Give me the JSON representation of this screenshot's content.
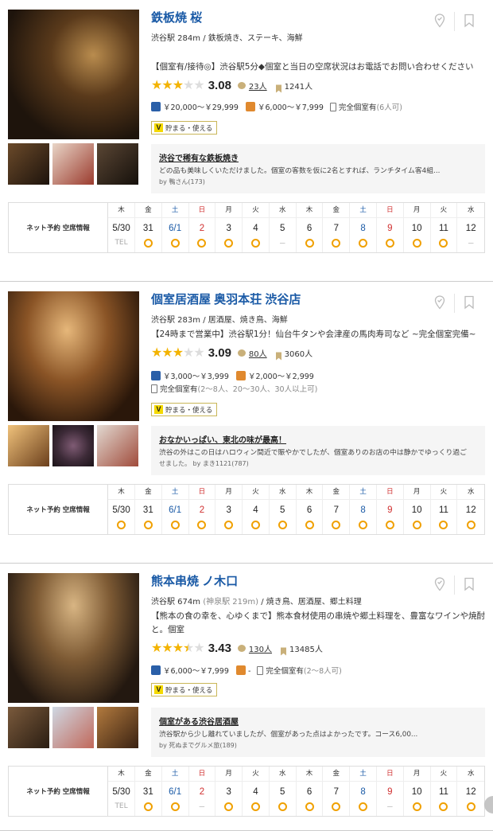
{
  "restaurants": [
    {
      "name": "鉄板焼 桜",
      "station": "渋谷駅 284m",
      "alt_station": "",
      "genres": "鉄板焼き、ステーキ、海鮮",
      "catch": "【個室有/接待◎】渋谷駅5分◆個室と当日の空席状況はお電話でお問い合わせください",
      "rating": 3.08,
      "rating_text": "3.08",
      "review_count": "23人",
      "bookmark_count": "1241人",
      "dinner_price": "￥20,000～￥29,999",
      "lunch_price": "￥6,000～￥7,999",
      "room_text": "完全個室有",
      "room_detail": "(6人可)",
      "points_label": "貯まる・使える",
      "review_title": "渋谷で稀有な鉄板焼き",
      "review_body": "どの品も美味しくいただけました。個室の客数を仮に2名とすれば、ランチタイム客4組...",
      "review_by": "by 鴨さん(173)",
      "availability_label": "ネット予約 空席情報",
      "days": [
        {
          "dow": "木",
          "date": "5/30",
          "mark": "TEL",
          "kind": "wd"
        },
        {
          "dow": "金",
          "date": "31",
          "mark": "o",
          "kind": "wd"
        },
        {
          "dow": "土",
          "date": "6/1",
          "mark": "o",
          "kind": "sat"
        },
        {
          "dow": "日",
          "date": "2",
          "mark": "o",
          "kind": "sun"
        },
        {
          "dow": "月",
          "date": "3",
          "mark": "o",
          "kind": "wd"
        },
        {
          "dow": "火",
          "date": "4",
          "mark": "o",
          "kind": "wd"
        },
        {
          "dow": "水",
          "date": "5",
          "mark": "－",
          "kind": "wd"
        },
        {
          "dow": "木",
          "date": "6",
          "mark": "o",
          "kind": "wd"
        },
        {
          "dow": "金",
          "date": "7",
          "mark": "o",
          "kind": "wd"
        },
        {
          "dow": "土",
          "date": "8",
          "mark": "o",
          "kind": "sat"
        },
        {
          "dow": "日",
          "date": "9",
          "mark": "o",
          "kind": "sun"
        },
        {
          "dow": "月",
          "date": "10",
          "mark": "o",
          "kind": "wd"
        },
        {
          "dow": "火",
          "date": "11",
          "mark": "o",
          "kind": "wd"
        },
        {
          "dow": "水",
          "date": "12",
          "mark": "－",
          "kind": "wd"
        }
      ]
    },
    {
      "name": "個室居酒屋 奥羽本荘 渋谷店",
      "station": "渋谷駅 283m",
      "alt_station": "",
      "genres": "居酒屋、焼き鳥、海鮮",
      "catch": "【24時まで営業中】渋谷駅1分！仙台牛タンや会津産の馬肉寿司など ~完全個室完備~",
      "rating": 3.09,
      "rating_text": "3.09",
      "review_count": "80人",
      "bookmark_count": "3060人",
      "dinner_price": "￥3,000～￥3,999",
      "lunch_price": "￥2,000～￥2,999",
      "room_text": "完全個室有",
      "room_detail": "(2～8人、20～30人、30人以上可)",
      "points_label": "貯まる・使える",
      "review_title": "おなかいっぱい、東北の味が最高！",
      "review_body": "渋谷の外はこの日はハロウィン間近で賑やかでしたが、個室ありのお店の中は静かでゆっくり過ご",
      "review_body2": "せました。",
      "review_by": "by まき1121(787)",
      "availability_label": "ネット予約 空席情報",
      "days": [
        {
          "dow": "木",
          "date": "5/30",
          "mark": "o",
          "kind": "wd"
        },
        {
          "dow": "金",
          "date": "31",
          "mark": "o",
          "kind": "wd"
        },
        {
          "dow": "土",
          "date": "6/1",
          "mark": "o",
          "kind": "sat"
        },
        {
          "dow": "日",
          "date": "2",
          "mark": "o",
          "kind": "sun"
        },
        {
          "dow": "月",
          "date": "3",
          "mark": "o",
          "kind": "wd"
        },
        {
          "dow": "火",
          "date": "4",
          "mark": "o",
          "kind": "wd"
        },
        {
          "dow": "水",
          "date": "5",
          "mark": "o",
          "kind": "wd"
        },
        {
          "dow": "木",
          "date": "6",
          "mark": "o",
          "kind": "wd"
        },
        {
          "dow": "金",
          "date": "7",
          "mark": "o",
          "kind": "wd"
        },
        {
          "dow": "土",
          "date": "8",
          "mark": "o",
          "kind": "sat"
        },
        {
          "dow": "日",
          "date": "9",
          "mark": "o",
          "kind": "sun"
        },
        {
          "dow": "月",
          "date": "10",
          "mark": "o",
          "kind": "wd"
        },
        {
          "dow": "火",
          "date": "11",
          "mark": "o",
          "kind": "wd"
        },
        {
          "dow": "水",
          "date": "12",
          "mark": "o",
          "kind": "wd"
        }
      ]
    },
    {
      "name": "熊本串焼 ノ木口",
      "station": "渋谷駅 674m",
      "alt_station": "(神泉駅 219m)",
      "genres": "焼き鳥、居酒屋、郷土料理",
      "catch": "【熊本の食の幸を、心ゆくまで】熊本食材使用の串焼や郷土料理を、豊富なワインや焼酎と。個室",
      "rating": 3.43,
      "rating_text": "3.43",
      "review_count": "130人",
      "bookmark_count": "13485人",
      "dinner_price": "￥6,000～￥7,999",
      "lunch_price": "-",
      "room_text": "完全個室有",
      "room_detail": "(2～8人可)",
      "points_label": "貯まる・使える",
      "review_title": "個室がある渋谷居酒屋",
      "review_body": "渋谷駅から少し離れていましたが、個室があった点はよかったです。コース6,00...",
      "review_by": "by 死ぬまでグルメ旅(189)",
      "availability_label": "ネット予約 空席情報",
      "days": [
        {
          "dow": "木",
          "date": "5/30",
          "mark": "TEL",
          "kind": "wd"
        },
        {
          "dow": "金",
          "date": "31",
          "mark": "o",
          "kind": "wd"
        },
        {
          "dow": "土",
          "date": "6/1",
          "mark": "o",
          "kind": "sat"
        },
        {
          "dow": "日",
          "date": "2",
          "mark": "－",
          "kind": "sun"
        },
        {
          "dow": "月",
          "date": "3",
          "mark": "o",
          "kind": "wd"
        },
        {
          "dow": "火",
          "date": "4",
          "mark": "o",
          "kind": "wd"
        },
        {
          "dow": "水",
          "date": "5",
          "mark": "o",
          "kind": "wd"
        },
        {
          "dow": "木",
          "date": "6",
          "mark": "o",
          "kind": "wd"
        },
        {
          "dow": "金",
          "date": "7",
          "mark": "o",
          "kind": "wd"
        },
        {
          "dow": "土",
          "date": "8",
          "mark": "o",
          "kind": "sat"
        },
        {
          "dow": "日",
          "date": "9",
          "mark": "－",
          "kind": "sun"
        },
        {
          "dow": "月",
          "date": "10",
          "mark": "o",
          "kind": "wd"
        },
        {
          "dow": "火",
          "date": "11",
          "mark": "o",
          "kind": "wd"
        },
        {
          "dow": "水",
          "date": "12",
          "mark": "o",
          "kind": "wd"
        }
      ]
    }
  ],
  "colors": {
    "link": "#1a5aa6",
    "star": "#f3b300",
    "sat": "#1a5aa6",
    "sun": "#d03030",
    "available": "#f0a000"
  },
  "icons": [
    "map-pin-icon",
    "bookmark-icon",
    "review-bubble-icon",
    "bookmark-count-icon",
    "dinner-icon",
    "lunch-icon",
    "room-icon",
    "t-point-icon",
    "scroll-top-icon"
  ]
}
